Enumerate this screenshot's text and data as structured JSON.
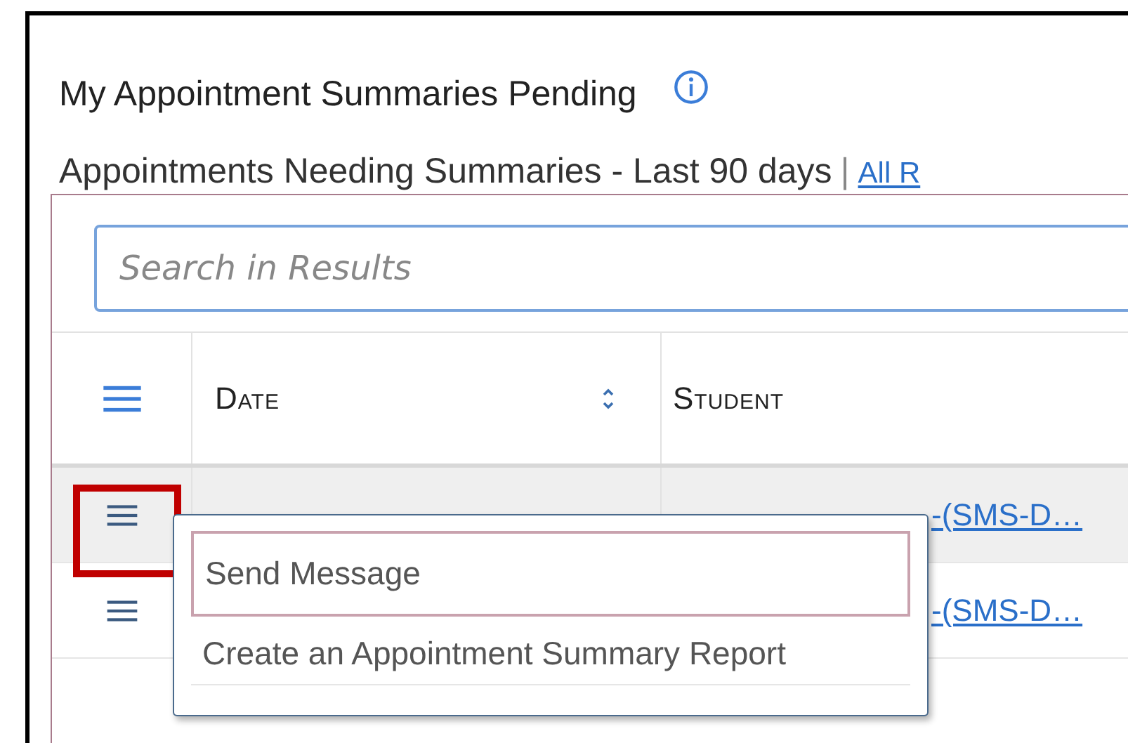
{
  "panel": {
    "title": "My Appointment Summaries Pending",
    "subtitle": "Appointments Needing Summaries - Last 90 days",
    "separator": "|",
    "link": "All R"
  },
  "search": {
    "placeholder": "Search in Results"
  },
  "table": {
    "columns": [
      "Date",
      "Student"
    ],
    "rows": [
      {
        "student": "-(SMS-D…",
        "highlighted": true
      },
      {
        "student": "-(SMS-D…",
        "highlighted": false
      }
    ]
  },
  "row_menu": {
    "items": [
      {
        "label": "Send Message",
        "selected": true
      },
      {
        "label": "Create an Appointment Summary Report",
        "selected": false
      }
    ]
  }
}
